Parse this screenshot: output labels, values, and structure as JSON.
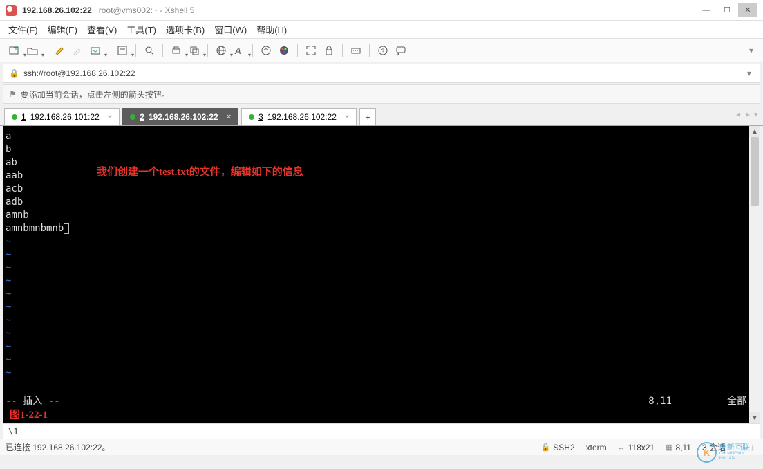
{
  "title": {
    "main": "192.168.26.102:22",
    "sub": "root@vms002:~ - Xshell 5"
  },
  "window_controls": {
    "min": "—",
    "max": "☐",
    "close": "✕"
  },
  "menu": {
    "file": "文件(F)",
    "edit": "编辑(E)",
    "view": "查看(V)",
    "tools": "工具(T)",
    "tabs": "选项卡(B)",
    "window": "窗口(W)",
    "help": "帮助(H)"
  },
  "address": {
    "url": "ssh://root@192.168.26.102:22"
  },
  "hint": {
    "text": "要添加当前会话，点击左侧的箭头按钮。"
  },
  "tabs": [
    {
      "num": "1",
      "label": "192.168.26.101:22",
      "active": false
    },
    {
      "num": "2",
      "label": "192.168.26.102:22",
      "active": true
    },
    {
      "num": "3",
      "label": "192.168.26.102:22",
      "active": false
    }
  ],
  "tab_add": "+",
  "terminal": {
    "lines": [
      "a",
      "b",
      "ab",
      "aab",
      "acb",
      "adb",
      "amnb",
      "amnbmnbmnb"
    ],
    "tilde_count": 11,
    "annotation": "我们创建一个test.txt的文件，编辑如下的信息",
    "mode": "-- 插入 --",
    "pos": "8,11",
    "scope": "全部",
    "figure": "图1-22-1"
  },
  "footer1": "\\1",
  "status": {
    "left": "已连接 192.168.26.102:22。",
    "ssh": "SSH2",
    "term": "xterm",
    "size": "118x21",
    "cursor": "8,11",
    "sessions": "3 会话"
  },
  "watermark": {
    "icon": "K",
    "text1": "创新互联",
    "text2": "CHUANGXIN HULIAN"
  }
}
